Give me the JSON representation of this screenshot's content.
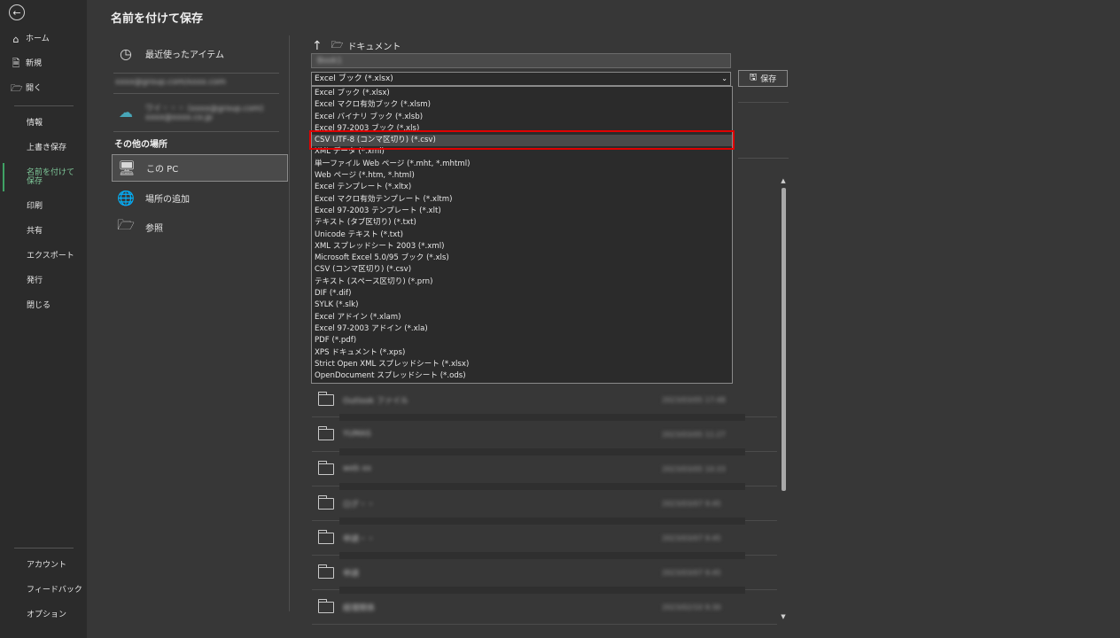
{
  "app": {
    "title": "名前を付けて保存"
  },
  "sidebar": {
    "top_items": [
      {
        "icon": "home-icon",
        "label": "ホーム"
      },
      {
        "icon": "new-file-icon",
        "label": "新規"
      },
      {
        "icon": "open-folder-icon",
        "label": "開く"
      }
    ],
    "items": [
      "情報",
      "上書き保存",
      "名前を付けて保存",
      "印刷",
      "共有",
      "エクスポート",
      "発行",
      "閉じる"
    ],
    "active": "名前を付けて保存",
    "bottom_items": [
      "アカウント",
      "フィードバック",
      "オプション"
    ]
  },
  "locations": {
    "recent": "最近使ったアイテム",
    "account_email": "xxxx@group.com/xxxx.com",
    "onedrive_line1": "ワイ・・・ (xxxx@group.com)",
    "onedrive_line2": "xxxx@xxxx.co.jp",
    "other_header": "その他の場所",
    "this_pc": "この PC",
    "add_place": "場所の追加",
    "browse": "参照"
  },
  "main": {
    "path_label": "ドキュメント",
    "filename_value": "Book1",
    "filetype_selected": "Excel ブック (*.xlsx)",
    "save_label": "保存"
  },
  "dropdown": {
    "options": [
      "Excel ブック (*.xlsx)",
      "Excel マクロ有効ブック (*.xlsm)",
      "Excel バイナリ ブック (*.xlsb)",
      "Excel 97-2003 ブック (*.xls)",
      "CSV UTF-8 (コンマ区切り) (*.csv)",
      "XML データ (*.xml)",
      "単一ファイル Web ページ (*.mht, *.mhtml)",
      "Web ページ (*.htm, *.html)",
      "Excel テンプレート (*.xltx)",
      "Excel マクロ有効テンプレート (*.xltm)",
      "Excel 97-2003 テンプレート (*.xlt)",
      "テキスト (タブ区切り) (*.txt)",
      "Unicode テキスト (*.txt)",
      "XML スプレッドシート 2003 (*.xml)",
      "Microsoft Excel 5.0/95 ブック (*.xls)",
      "CSV (コンマ区切り) (*.csv)",
      "テキスト (スペース区切り) (*.prn)",
      "DIF (*.dif)",
      "SYLK (*.slk)",
      "Excel アドイン (*.xlam)",
      "Excel 97-2003 アドイン (*.xla)",
      "PDF (*.pdf)",
      "XPS ドキュメント (*.xps)",
      "Strict Open XML スプレッドシート (*.xlsx)",
      "OpenDocument スプレッドシート (*.ods)"
    ],
    "highlighted": "CSV UTF-8 (コンマ区切り) (*.csv)"
  },
  "files": [
    {
      "name": "Outlook ファイル",
      "date": "2023/03/05 17:48"
    },
    {
      "name": "YUMAS",
      "date": "2023/03/05 11:27"
    },
    {
      "name": "web xx",
      "date": "2023/03/05 10:33"
    },
    {
      "name": "ログ・・",
      "date": "2023/03/07 9:45"
    },
    {
      "name": "申請・・",
      "date": "2023/03/07 9:45"
    },
    {
      "name": "申請",
      "date": "2023/03/07 9:45"
    },
    {
      "name": "経理関係",
      "date": "2023/02/10 9:30"
    }
  ]
}
